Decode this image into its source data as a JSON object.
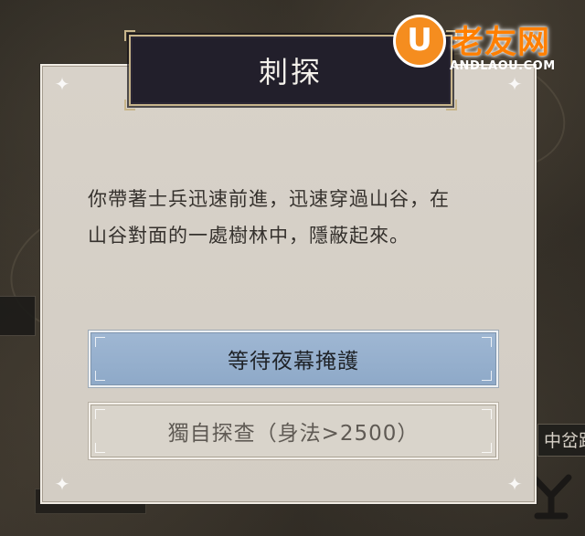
{
  "dialog": {
    "title": "刺探",
    "story_text": "你帶著士兵迅速前進，迅速穿過山谷，在\n山谷對面的一處樹林中，隱蔽起來。",
    "choices": [
      {
        "label": "等待夜幕掩護"
      },
      {
        "label": "獨自探查（身法>2500）"
      }
    ]
  },
  "background": {
    "right_map_label": "中岔路"
  },
  "watermark": {
    "mark": "U",
    "name": "老友网",
    "url": "ANDLAOU.COM"
  },
  "colors": {
    "title_bg": "#221f2b",
    "primary_button": "#9fb7d3",
    "dialog_bg": "#d8d2c9",
    "watermark_orange": "#f58d1f"
  }
}
